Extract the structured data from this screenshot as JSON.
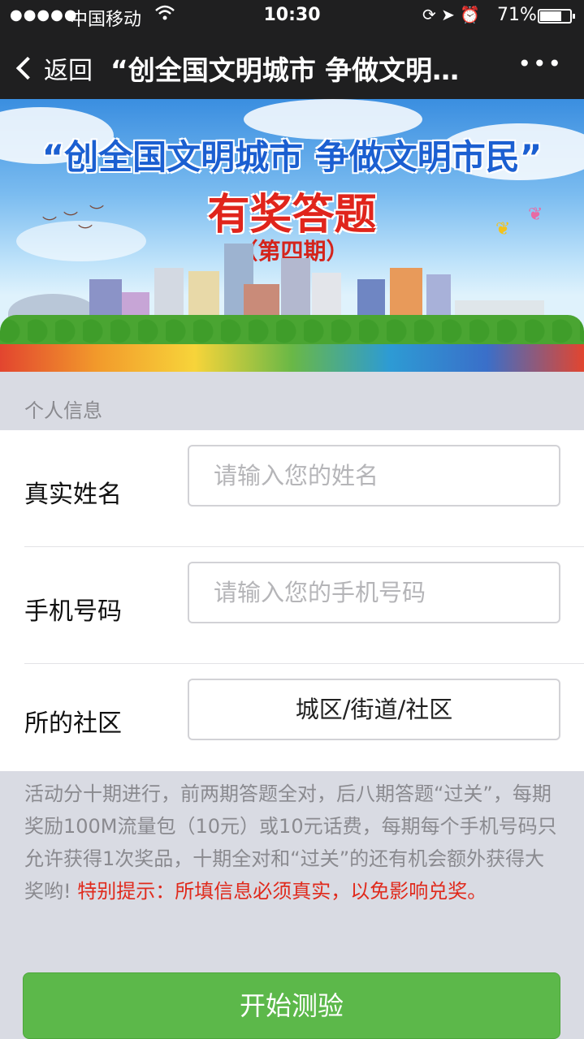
{
  "status_bar": {
    "signal": "●●●●●",
    "carrier": "中国移动",
    "time": "10:30",
    "battery_pct": "71%",
    "battery_level": 0.71
  },
  "nav": {
    "back_label": "返回",
    "title": "“创全国文明城市 争做文明…",
    "more": "•••"
  },
  "banner": {
    "slogan": "“创全国文明城市 争做文明市民”",
    "subtitle": "有奖答题",
    "issue": "（第四期）"
  },
  "section": {
    "title": "个人信息"
  },
  "form": {
    "name_label": "真实姓名",
    "name_placeholder": "请输入您的姓名",
    "phone_label": "手机号码",
    "phone_placeholder": "请输入您的手机号码",
    "community_label": "所的社区",
    "community_value": "城区/街道/社区"
  },
  "notice": {
    "text": "活动分十期进行，前两期答题全对，后八期答题“过关”，每期奖励100M流量包（10元）或10元话费，每期每个手机号码只允许获得1次奖品，十期全对和“过关”的还有机会额外获得大奖哟! ",
    "warning": "特别提示：所填信息必须真实，以免影响兑奖。"
  },
  "button": {
    "start_label": "开始测验"
  },
  "colors": {
    "bar_bg": "#1f1f20",
    "accent_green": "#5cb84a",
    "warning_red": "#e02a1c",
    "page_bg": "#d9dbe3"
  }
}
